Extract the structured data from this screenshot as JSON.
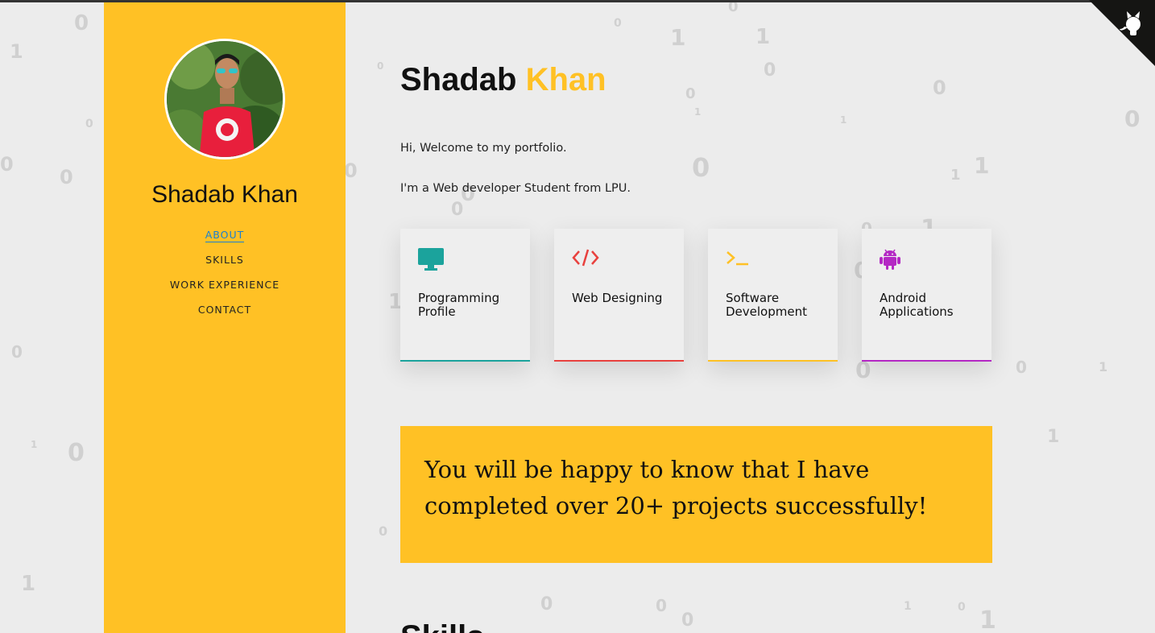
{
  "sidebar": {
    "name": "Shadab Khan",
    "nav": [
      "ABOUT",
      "SKILLS",
      "WORK EXPERIENCE",
      "CONTACT"
    ],
    "active_index": 0
  },
  "header": {
    "first_name": "Shadab",
    "last_name": "Khan"
  },
  "intro": {
    "line1": "Hi, Welcome to my portfolio.",
    "line2": "I'm a Web developer Student from LPU."
  },
  "cards": [
    {
      "label": "Programming Profile",
      "icon": "monitor-icon",
      "color": "#1ba39c"
    },
    {
      "label": "Web Designing",
      "icon": "code-icon",
      "color": "#e8413e"
    },
    {
      "label": "Software Development",
      "icon": "terminal-icon",
      "color": "#ffc125"
    },
    {
      "label": "Android Applications",
      "icon": "android-icon",
      "color": "#b428c4"
    }
  ],
  "banner": {
    "text": "You will be happy to know that I have completed over 20+ projects successfully!"
  },
  "section": {
    "skills_heading": "Skills"
  },
  "colors": {
    "accent": "#ffc125",
    "background": "#ececec",
    "nav_active": "#1a7fd0"
  }
}
